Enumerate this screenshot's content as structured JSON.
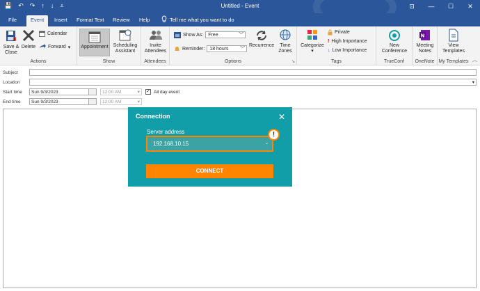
{
  "window": {
    "title": "Untitled  -  Event",
    "qat": [
      "💾",
      "↶",
      "↷",
      "↑",
      "↓",
      "⩡"
    ],
    "controls": [
      "⊡",
      "—",
      "☐",
      "✕"
    ]
  },
  "tabs": [
    "File",
    "Event",
    "Insert",
    "Format Text",
    "Review",
    "Help"
  ],
  "tell_me": "Tell me what you want to do",
  "ribbon": {
    "actions": {
      "save_close": "Save &\nClose",
      "delete": "Delete",
      "calendar": "Calendar",
      "forward": "Forward",
      "label": "Actions"
    },
    "show": {
      "appointment": "Appointment",
      "scheduling": "Scheduling\nAssistant",
      "label": "Show"
    },
    "attendees": {
      "invite": "Invite\nAttendees",
      "label": "Attendees"
    },
    "options": {
      "show_as_label": "Show As:",
      "show_as_value": "Free",
      "reminder_label": "Reminder:",
      "reminder_value": "18 hours",
      "recurrence": "Recurrence",
      "time_zones": "Time\nZones",
      "label": "Options"
    },
    "tags": {
      "categorize": "Categorize",
      "private": "Private",
      "high": "High Importance",
      "low": "Low Importance",
      "label": "Tags"
    },
    "trueconf": {
      "new_conf": "New\nConference",
      "label": "TrueConf"
    },
    "onenote": {
      "notes": "Meeting\nNotes",
      "label": "OneNote"
    },
    "templates": {
      "view": "View\nTemplates",
      "label": "My Templates"
    }
  },
  "form": {
    "subject_label": "Subject",
    "location_label": "Location",
    "start_label": "Start time",
    "start_date": "Sun 9/3/2023",
    "start_time": "12:00 AM",
    "all_day": "All day event",
    "end_label": "End time",
    "end_date": "Sun 9/3/2023",
    "end_time": "12:00 AM"
  },
  "dialog": {
    "title": "Connection",
    "field_label": "Server address",
    "field_value": "192.168.10.15",
    "connect": "CONNECT"
  },
  "colors": {
    "titlebar": "#2b579a",
    "dialog": "#129ea8",
    "accent": "#ff8400"
  }
}
